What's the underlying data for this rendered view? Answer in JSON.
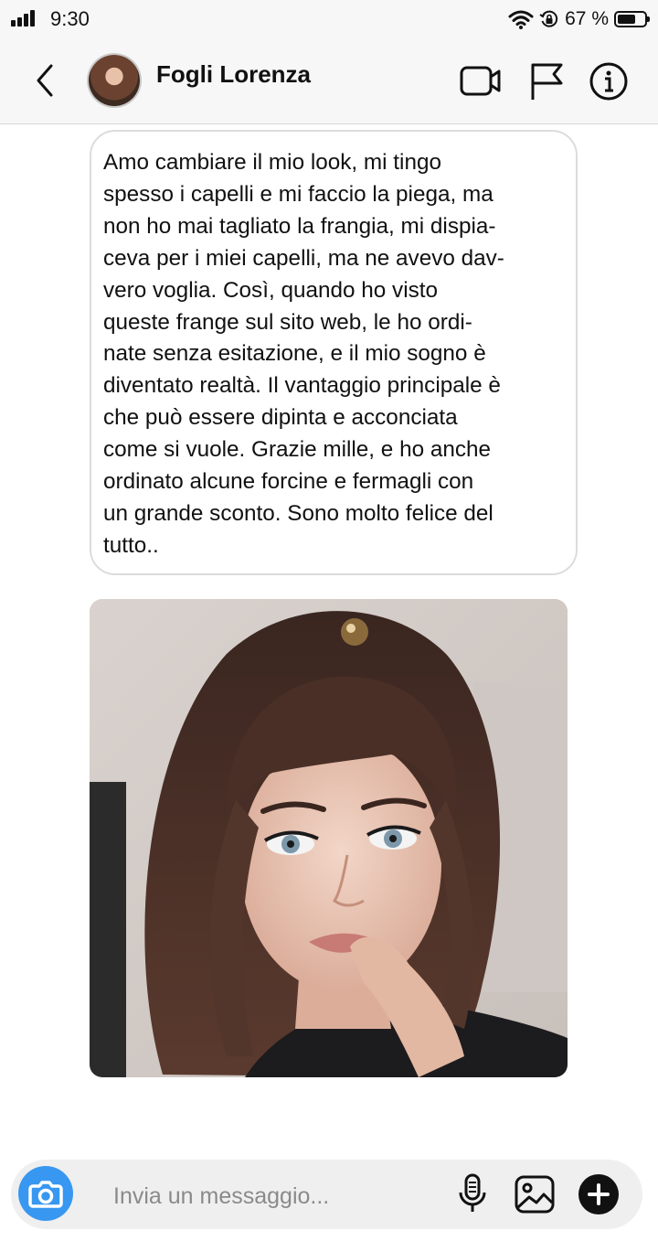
{
  "status_bar": {
    "time": "9:30",
    "battery_percent": "67 %",
    "battery_level": 0.67,
    "icons": [
      "signal-icon",
      "wifi-icon",
      "rotation-lock-icon",
      "battery-icon"
    ]
  },
  "header": {
    "contact_name": "Fogli Lorenza",
    "icons": [
      "back-chevron-icon",
      "video-call-icon",
      "flag-icon",
      "info-icon"
    ]
  },
  "messages": [
    {
      "type": "text",
      "text": "Amo cambiare il mio look, mi tingo\nspesso i capelli e mi faccio la piega, ma\nnon ho mai tagliato la frangia, mi dispia-\nceva per i miei capelli, ma ne avevo dav-\nvero voglia. Così, quando ho visto\nqueste frange sul sito web, le ho ordi-\nnate senza esitazione, e il mio sogno è\ndiventato realtà. Il vantaggio principale è\nche può essere dipinta e acconciata\ncome si vuole. Grazie mille, e ho anche\nordinato alcune forcine e fermagli con\nun grande sconto. Sono molto felice del\ntutto.."
    },
    {
      "type": "image",
      "subject": "portrait-photo"
    }
  ],
  "composer": {
    "placeholder": "Invia un messaggio...",
    "value": "",
    "icons": [
      "camera-icon",
      "microphone-icon",
      "gallery-icon",
      "plus-icon"
    ]
  },
  "colors": {
    "camera_button": "#3897f0",
    "bar_background": "#f7f7f7",
    "bubble_border": "#dcdcdc",
    "composer_background": "#efefef"
  }
}
